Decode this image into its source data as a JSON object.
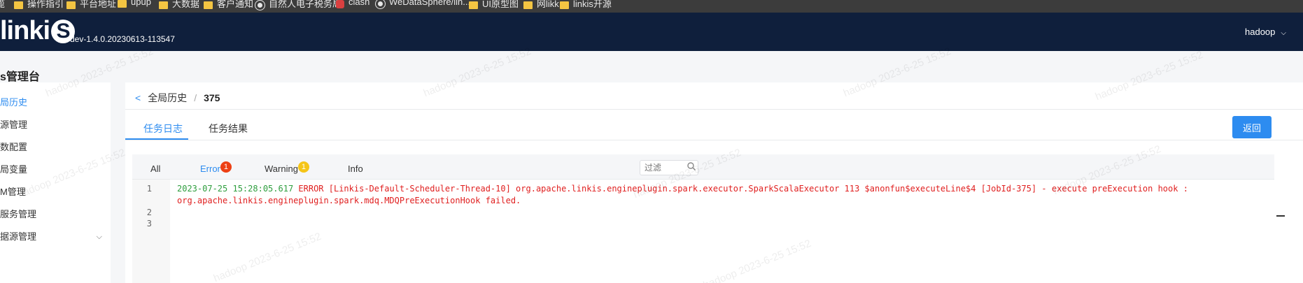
{
  "bookmarks": [
    {
      "label": "操作指引",
      "icon": "folder-icon"
    },
    {
      "label": "平台地址",
      "icon": "folder-icon"
    },
    {
      "label": "upup",
      "icon": "folder-icon"
    },
    {
      "label": "大数据",
      "icon": "folder-icon"
    },
    {
      "label": "客户通知",
      "icon": "folder-icon"
    },
    {
      "label": "自然人电子税务局",
      "icon": "globe-icon"
    },
    {
      "label": "clash",
      "icon": "clash-icon"
    },
    {
      "label": "WeDataSphere/lin...",
      "icon": "github-icon"
    },
    {
      "label": "UI原型图",
      "icon": "folder-icon"
    },
    {
      "label": "网likk",
      "icon": "folder-icon"
    },
    {
      "label": "linkis开源",
      "icon": "folder-icon"
    }
  ],
  "header": {
    "logo_text": "linki",
    "logo_s": "S",
    "version": "dev-1.4.0.20230613-113547",
    "user": "hadoop"
  },
  "sidebar": {
    "title": "s管理台",
    "items": [
      {
        "label": "局历史",
        "active": true
      },
      {
        "label": "源管理"
      },
      {
        "label": "数配置"
      },
      {
        "label": "局变量"
      },
      {
        "label": "M管理"
      },
      {
        "label": "服务管理"
      },
      {
        "label": "据源管理"
      }
    ]
  },
  "breadcrumb": {
    "parent": "全局历史",
    "separator": "/",
    "current": "375"
  },
  "tabs": [
    {
      "label": "任务日志",
      "active": true
    },
    {
      "label": "任务结果"
    }
  ],
  "return_button": "返回",
  "log_tabs": {
    "all": "All",
    "error": "Error",
    "error_count": "1",
    "warning": "Warning",
    "warning_count": "1",
    "info": "Info"
  },
  "filter_placeholder": "过滤",
  "log_lines": {
    "n1": "1",
    "n2": "2",
    "n3": "3",
    "timestamp": "2023-07-25 15:28:05.617",
    "line1_msg": " ERROR [Linkis-Default-Scheduler-Thread-10] org.apache.linkis.engineplugin.spark.executor.SparkScalaExecutor 113 $anonfun$executeLine$4 [JobId-375] - execute preExecution hook :",
    "line1_cont": "org.apache.linkis.engineplugin.spark.mdq.MDQPreExecutionHook failed."
  },
  "watermark": "hadoop 2023-6-25 15:52",
  "colors": {
    "header_bg": "#0f1f3c",
    "accent": "#2d8cf0",
    "error": "#e02020",
    "timestamp": "#2e9e3e"
  }
}
